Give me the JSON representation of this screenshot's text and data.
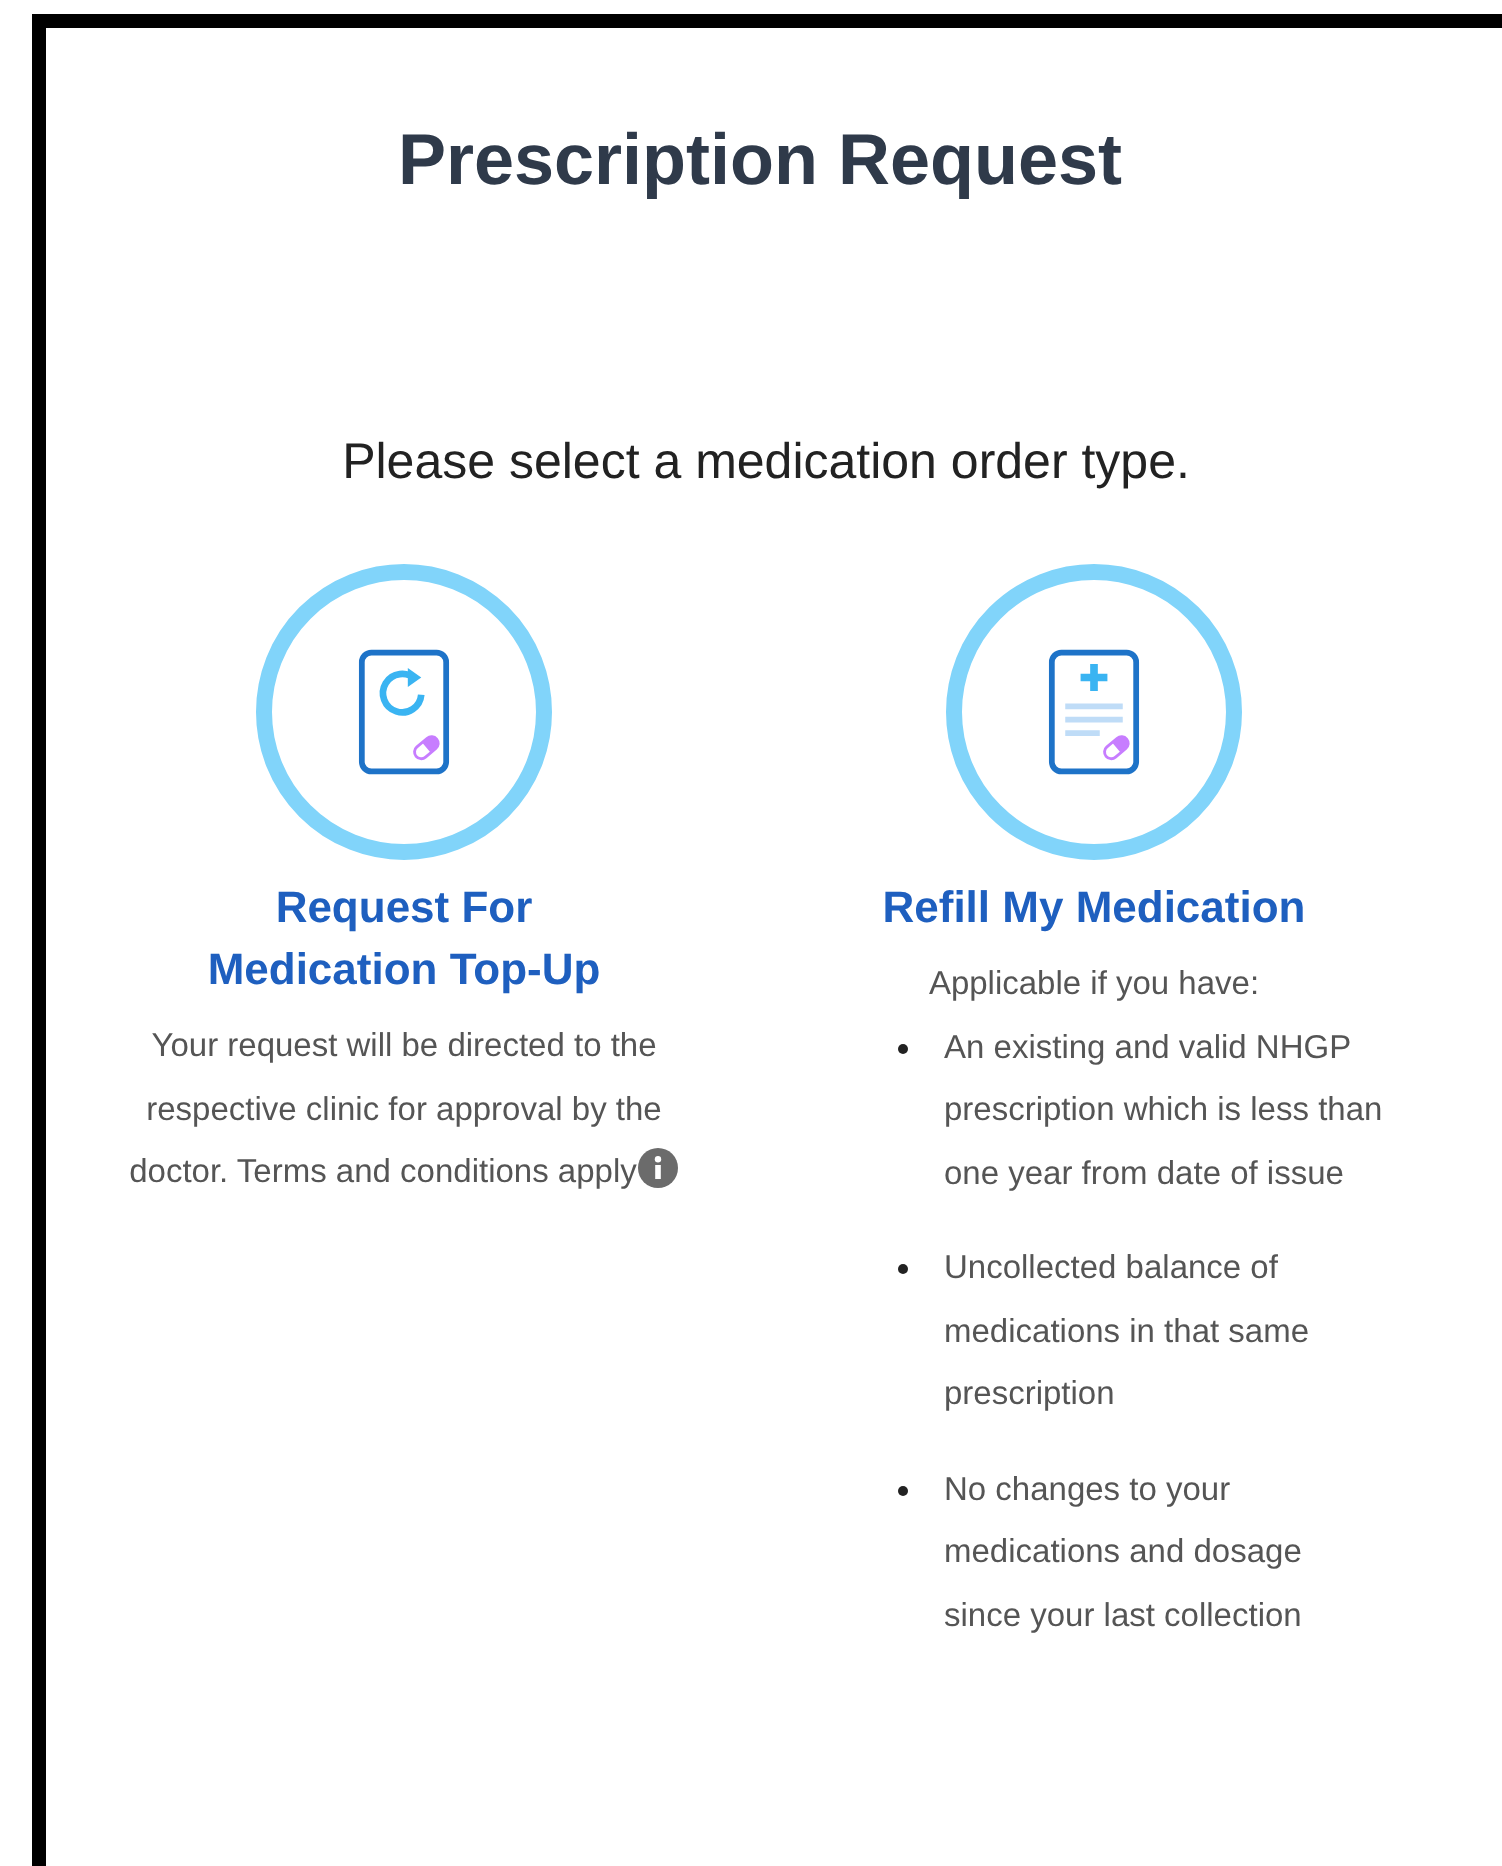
{
  "title": "Prescription Request",
  "prompt": "Please select a medication order type.",
  "options": [
    {
      "kind": "top-up",
      "title": "Request For Medication Top-Up",
      "description": "Your request will be directed to the respective clinic for approval by the doctor. Terms and conditions apply"
    },
    {
      "kind": "refill",
      "title": "Refill My Medication",
      "description": "Applicable if you have:",
      "bullets": [
        "An existing and valid NHGP prescription which is less than one year from date of issue",
        "Uncollected balance of medications in that same prescription",
        "No changes to your medications and dosage since your last collection"
      ]
    }
  ]
}
